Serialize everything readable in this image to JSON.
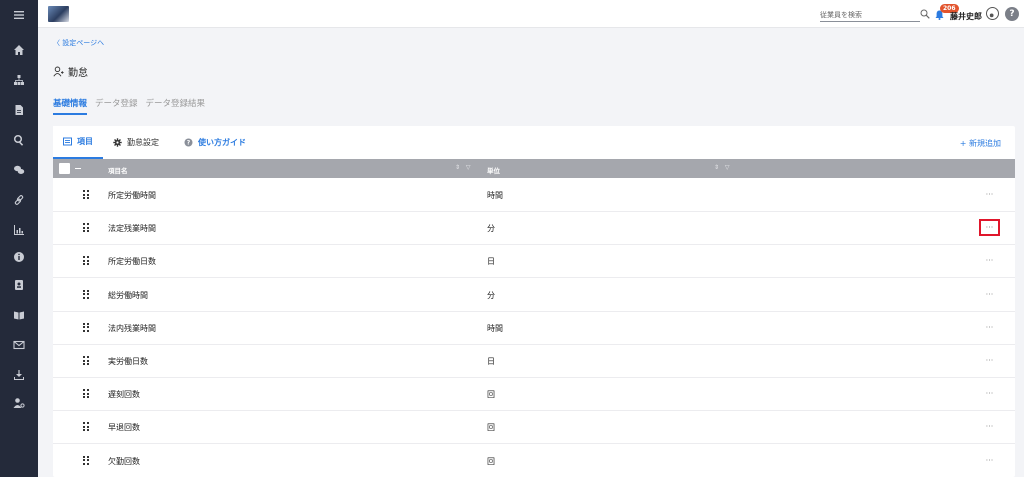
{
  "header": {
    "search_placeholder": "従業員を検索",
    "badge_count": "206",
    "user_name": "藤井史郎",
    "help_label": "?"
  },
  "sidebar": {
    "icons": [
      "menu-icon",
      "home-icon",
      "org-chart-icon",
      "document-icon",
      "search-icon",
      "chat-icon",
      "link-icon",
      "chart-icon",
      "info-icon",
      "contact-card-icon",
      "book-icon",
      "mail-icon",
      "download-icon",
      "user-settings-icon"
    ]
  },
  "page": {
    "back_link": "〈 設定ページへ",
    "title": "勤怠",
    "tabs": [
      {
        "label": "基礎情報",
        "active": true
      },
      {
        "label": "データ登録",
        "active": false
      },
      {
        "label": "データ登録結果",
        "active": false
      }
    ]
  },
  "card": {
    "subtabs": [
      {
        "label": "項目",
        "active": true
      },
      {
        "label": "勤怠設定",
        "active": false
      },
      {
        "label": "使い方ガイド",
        "active": false
      }
    ],
    "add_label": "+ 新規追加",
    "columns": {
      "name": "項目名",
      "unit": "単位"
    },
    "rows": [
      {
        "name": "所定労働時間",
        "unit": "時間",
        "highlighted": false
      },
      {
        "name": "法定残業時間",
        "unit": "分",
        "highlighted": true
      },
      {
        "name": "所定労働日数",
        "unit": "日",
        "highlighted": false
      },
      {
        "name": "総労働時間",
        "unit": "分",
        "highlighted": false
      },
      {
        "name": "法内残業時間",
        "unit": "時間",
        "highlighted": false
      },
      {
        "name": "実労働日数",
        "unit": "日",
        "highlighted": false
      },
      {
        "name": "遅刻回数",
        "unit": "回",
        "highlighted": false
      },
      {
        "name": "早退回数",
        "unit": "回",
        "highlighted": false
      },
      {
        "name": "欠勤回数",
        "unit": "回",
        "highlighted": false
      }
    ],
    "more_label": "···"
  },
  "colors": {
    "sidebar_bg": "#242a3a",
    "accent": "#2b7be0",
    "table_header": "#a5a7ad",
    "highlight_box": "#e0162b",
    "badge": "#e2542d"
  }
}
